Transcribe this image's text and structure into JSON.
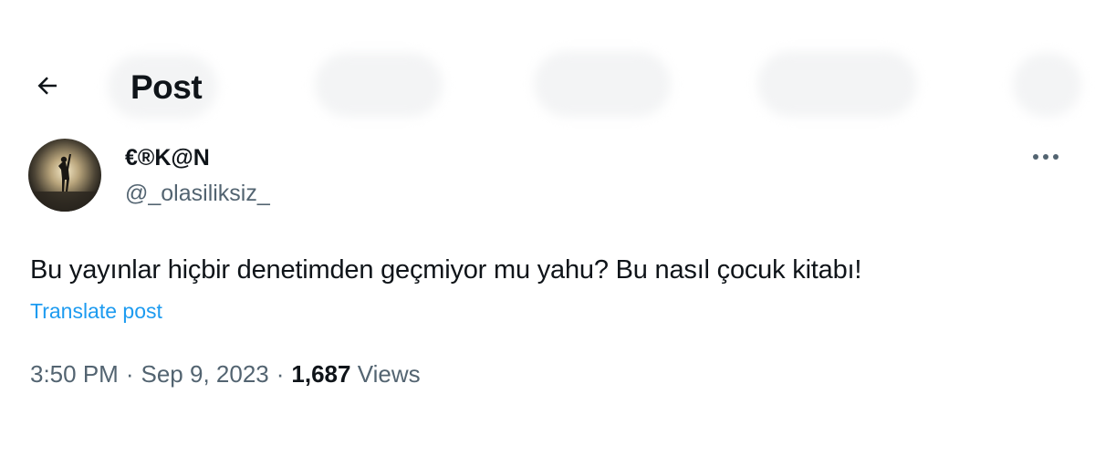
{
  "header": {
    "title": "Post"
  },
  "author": {
    "display_name": "€®K@N",
    "handle": "@_olasiliksiz_"
  },
  "post": {
    "text": "Bu yayınlar hiçbir denetimden geçmiyor mu yahu? Bu nasıl çocuk kitabı!",
    "translate_label": "Translate post",
    "time": "3:50 PM",
    "date": "Sep 9, 2023",
    "separator": "·",
    "views_count": "1,687",
    "views_label": "Views"
  },
  "icons": {
    "back": "arrow-left-icon",
    "more": "more-horizontal-icon"
  },
  "colors": {
    "link": "#1d9bf0",
    "secondary_text": "#536471",
    "primary_text": "#0f1419"
  }
}
